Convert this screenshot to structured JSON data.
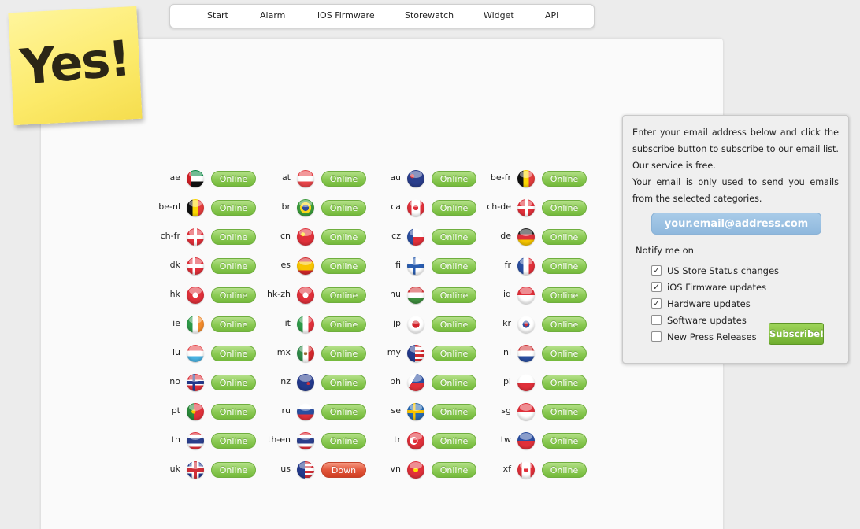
{
  "logo": {
    "text": "Yes!"
  },
  "nav": {
    "items": [
      {
        "label": "Start"
      },
      {
        "label": "Alarm"
      },
      {
        "label": "iOS Firmware"
      },
      {
        "label": "Storewatch"
      },
      {
        "label": "Widget"
      },
      {
        "label": "API"
      }
    ]
  },
  "countries": [
    {
      "code": "ae",
      "status": "Online",
      "flag": "uae-flag-icon"
    },
    {
      "code": "at",
      "status": "Online",
      "flag": "austria-flag-icon"
    },
    {
      "code": "au",
      "status": "Online",
      "flag": "australia-flag-icon"
    },
    {
      "code": "be-fr",
      "status": "Online",
      "flag": "belgium-flag-icon"
    },
    {
      "code": "be-nl",
      "status": "Online",
      "flag": "belgium-flag-icon"
    },
    {
      "code": "br",
      "status": "Online",
      "flag": "brazil-flag-icon"
    },
    {
      "code": "ca",
      "status": "Online",
      "flag": "canada-flag-icon"
    },
    {
      "code": "ch-de",
      "status": "Online",
      "flag": "switzerland-flag-icon"
    },
    {
      "code": "ch-fr",
      "status": "Online",
      "flag": "switzerland-flag-icon"
    },
    {
      "code": "cn",
      "status": "Online",
      "flag": "china-flag-icon"
    },
    {
      "code": "cz",
      "status": "Online",
      "flag": "czech-flag-icon"
    },
    {
      "code": "de",
      "status": "Online",
      "flag": "germany-flag-icon"
    },
    {
      "code": "dk",
      "status": "Online",
      "flag": "denmark-flag-icon"
    },
    {
      "code": "es",
      "status": "Online",
      "flag": "spain-flag-icon"
    },
    {
      "code": "fi",
      "status": "Online",
      "flag": "finland-flag-icon"
    },
    {
      "code": "fr",
      "status": "Online",
      "flag": "france-flag-icon"
    },
    {
      "code": "hk",
      "status": "Online",
      "flag": "hongkong-flag-icon"
    },
    {
      "code": "hk-zh",
      "status": "Online",
      "flag": "hongkong-flag-icon"
    },
    {
      "code": "hu",
      "status": "Online",
      "flag": "hungary-flag-icon"
    },
    {
      "code": "id",
      "status": "Online",
      "flag": "indonesia-flag-icon"
    },
    {
      "code": "ie",
      "status": "Online",
      "flag": "ireland-flag-icon"
    },
    {
      "code": "it",
      "status": "Online",
      "flag": "italy-flag-icon"
    },
    {
      "code": "jp",
      "status": "Online",
      "flag": "japan-flag-icon"
    },
    {
      "code": "kr",
      "status": "Online",
      "flag": "korea-flag-icon"
    },
    {
      "code": "lu",
      "status": "Online",
      "flag": "luxembourg-flag-icon"
    },
    {
      "code": "mx",
      "status": "Online",
      "flag": "mexico-flag-icon"
    },
    {
      "code": "my",
      "status": "Online",
      "flag": "malaysia-flag-icon"
    },
    {
      "code": "nl",
      "status": "Online",
      "flag": "netherlands-flag-icon"
    },
    {
      "code": "no",
      "status": "Online",
      "flag": "norway-flag-icon"
    },
    {
      "code": "nz",
      "status": "Online",
      "flag": "newzealand-flag-icon"
    },
    {
      "code": "ph",
      "status": "Online",
      "flag": "philippines-flag-icon"
    },
    {
      "code": "pl",
      "status": "Online",
      "flag": "poland-flag-icon"
    },
    {
      "code": "pt",
      "status": "Online",
      "flag": "portugal-flag-icon"
    },
    {
      "code": "ru",
      "status": "Online",
      "flag": "russia-flag-icon"
    },
    {
      "code": "se",
      "status": "Online",
      "flag": "sweden-flag-icon"
    },
    {
      "code": "sg",
      "status": "Online",
      "flag": "singapore-flag-icon"
    },
    {
      "code": "th",
      "status": "Online",
      "flag": "thailand-flag-icon"
    },
    {
      "code": "th-en",
      "status": "Online",
      "flag": "thailand-flag-icon"
    },
    {
      "code": "tr",
      "status": "Online",
      "flag": "turkey-flag-icon"
    },
    {
      "code": "tw",
      "status": "Online",
      "flag": "taiwan-flag-icon"
    },
    {
      "code": "uk",
      "status": "Online",
      "flag": "uk-flag-icon"
    },
    {
      "code": "us",
      "status": "Down",
      "flag": "usa-flag-icon"
    },
    {
      "code": "vn",
      "status": "Online",
      "flag": "vietnam-flag-icon"
    },
    {
      "code": "xf",
      "status": "Online",
      "flag": "canada-flag-icon"
    }
  ],
  "status_colors": {
    "online": "#8ccb55",
    "down": "#e2553a"
  },
  "subscribe": {
    "intro_line1": "Enter your email address below and click the subscribe button to subscribe to our email list. Our service is free.",
    "intro_line2": "Your email is only used to send you emails from the selected categories.",
    "email_placeholder": "your.email@address.com",
    "notify_label": "Notify me on",
    "categories": [
      {
        "label": "US Store Status changes",
        "checked": true
      },
      {
        "label": "iOS Firmware updates",
        "checked": true
      },
      {
        "label": "Hardware updates",
        "checked": true
      },
      {
        "label": "Software updates",
        "checked": false
      },
      {
        "label": "New Press Releases",
        "checked": false
      }
    ],
    "button_label": "Subscribe!"
  }
}
